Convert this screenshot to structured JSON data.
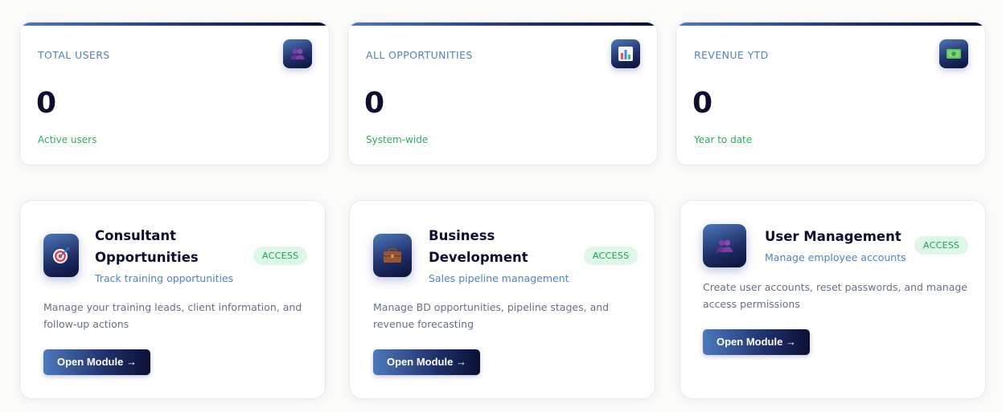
{
  "stats": [
    {
      "label": "TOTAL USERS",
      "value": "0",
      "sub": "Active users",
      "icon": "users-icon"
    },
    {
      "label": "ALL OPPORTUNITIES",
      "value": "0",
      "sub": "System-wide",
      "icon": "bar-chart-icon"
    },
    {
      "label": "REVENUE YTD",
      "value": "0",
      "sub": "Year to date",
      "icon": "money-icon"
    }
  ],
  "modules": [
    {
      "title_line1": "Consultant",
      "title_line2": "Opportunities",
      "subtitle": "Track training opportunities",
      "badge": "ACCESS",
      "desc_line1": "Manage your training leads, client information, and",
      "desc_line2": "follow-up actions",
      "button": "Open Module →",
      "icon": "target-icon"
    },
    {
      "title_line1": "Business",
      "title_line2": "Development",
      "subtitle": "Sales pipeline management",
      "badge": "ACCESS",
      "desc_line1": "Manage BD opportunities, pipeline stages, and",
      "desc_line2": "revenue forecasting",
      "button": "Open Module →",
      "icon": "briefcase-icon"
    },
    {
      "title_line1": "User Management",
      "subtitle": "Manage employee accounts",
      "badge": "ACCESS",
      "desc_line1": "Create user accounts, reset passwords, and manage",
      "desc_line2": "access permissions",
      "button": "Open Module →",
      "icon": "users-icon"
    }
  ],
  "colors": {
    "accent_blue": "#4f83c2",
    "navy": "#0b0e30",
    "success_green": "#2fae5a",
    "badge_bg": "#def7e7"
  }
}
